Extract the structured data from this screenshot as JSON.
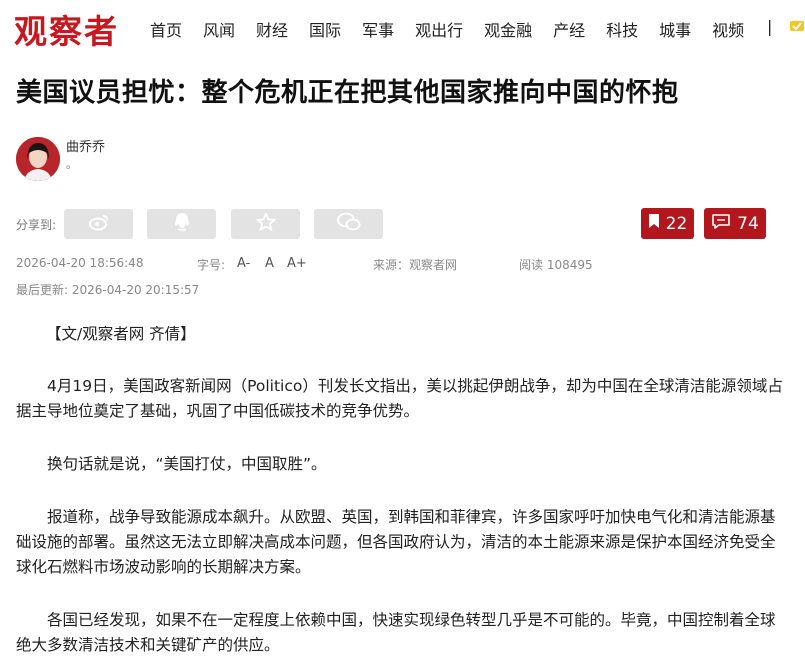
{
  "site": {
    "logo": "观察者"
  },
  "nav": {
    "items": [
      "首页",
      "风闻",
      "财经",
      "国际",
      "军事",
      "观出行",
      "观金融",
      "产经",
      "科技",
      "城事",
      "视频"
    ],
    "separator": "|"
  },
  "article": {
    "title": "美国议员担忧：整个危机正在把其他国家推向中国的怀抱",
    "author": {
      "name": "曲乔乔",
      "subtitle": "。"
    },
    "share_label": "分享到:",
    "favorite_count": "22",
    "comment_count": "74",
    "meta": {
      "date": "2026-04-20 18:56:48",
      "font_label": "字号:",
      "font_small": "A-",
      "font_normal": "A",
      "font_large": "A+",
      "source": "来源：观察者网",
      "reads": "阅读 108495",
      "updated": "最后更新: 2026-04-20 20:15:57"
    },
    "byline": "【文/观察者网 齐倩】",
    "paragraphs": [
      "4月19日，美国政客新闻网（Politico）刊发长文指出，美以挑起伊朗战争，却为中国在全球清洁能源领域占据主导地位奠定了基础，巩固了中国低碳技术的竞争优势。",
      "换句话就是说，“美国打仗，中国取胜”。",
      "报道称，战争导致能源成本飙升。从欧盟、英国，到韩国和菲律宾，许多国家呼吁加快电气化和清洁能源基础设施的部署。虽然这无法立即解决高成本问题，但各国政府认为，清洁的本土能源来源是保护本国经济免受全球化石燃料市场波动影响的长期解决方案。",
      "各国已经发现，如果不在一定程度上依赖中国，快速实现绿色转型几乎是不可能的。毕竟，中国控制着全球绝大多数清洁技术和关键矿产的供应。"
    ]
  },
  "colors": {
    "brand": "#c8171e",
    "button_red": "#b3161c",
    "share_bg": "#e3e3e3"
  },
  "icons": [
    "weibo-icon",
    "qq-icon",
    "star-icon",
    "wechat-icon",
    "bookmark-icon",
    "comment-icon"
  ]
}
